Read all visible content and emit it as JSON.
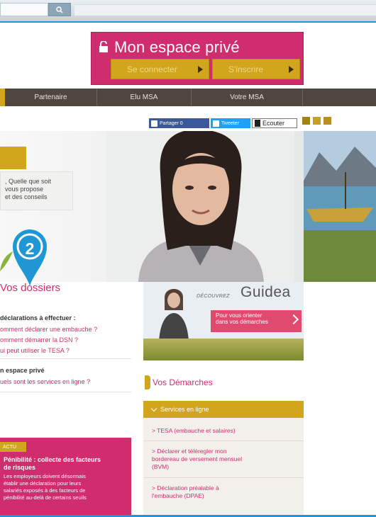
{
  "header": {
    "espace_title": "Mon espace privé",
    "connect_label": "Se connecter",
    "register_label": "S'inscrire"
  },
  "nav": {
    "items": [
      "Partenaire",
      "Elu MSA",
      "Votre MSA"
    ]
  },
  "share": {
    "facebook_label": "Partager 0",
    "twitter_label": "Tweeter",
    "listen_label": "Ecouter"
  },
  "hero": {
    "text_lines": [
      ", Quelle que soit",
      "vous propose",
      "et des conseils"
    ]
  },
  "marker": {
    "number": "2"
  },
  "dossiers": {
    "title": "Vos dossiers",
    "section1_title": "déclarations à effectuer :",
    "section1_links": [
      "omment déclarer une embauche ?",
      "omment démarrer la DSN ?",
      "ui peut utiliser le TESA ?"
    ],
    "section2_title": "n espace privé",
    "section2_links": [
      "uels sont les services en ligne ?"
    ]
  },
  "actu": {
    "badge": "ACTU",
    "headline_lines": [
      "Pénibilité : collecte des facteurs",
      "de risques"
    ],
    "body_lines": [
      "Les employeurs doivent désormais",
      "établir une déclaration pour leurs",
      "salariés exposés à des facteurs de",
      "pénibilité au-delà de certains seuils"
    ]
  },
  "guidea": {
    "decouvrez": "DÉCOUVREZ",
    "name": "Guidea",
    "cta_lines": [
      "Pour vous orienter",
      "dans vos démarches"
    ]
  },
  "demarches": {
    "title": "Vos Démarches",
    "services_head": "Services en ligne",
    "entries": [
      [
        "> TESA (embauche et salaires)"
      ],
      [
        "> Déclarer et téléregler mon",
        "bordereau de versement mensuel",
        "(BVM)"
      ],
      [
        "> Déclaration préalable à",
        "l'embauche (DPAE)"
      ]
    ]
  },
  "colors": {
    "brand_pink": "#cf2d6d",
    "brand_gold": "#d1a51c",
    "nav_brown": "#4f4640",
    "accent_blue": "#1f97d4"
  }
}
